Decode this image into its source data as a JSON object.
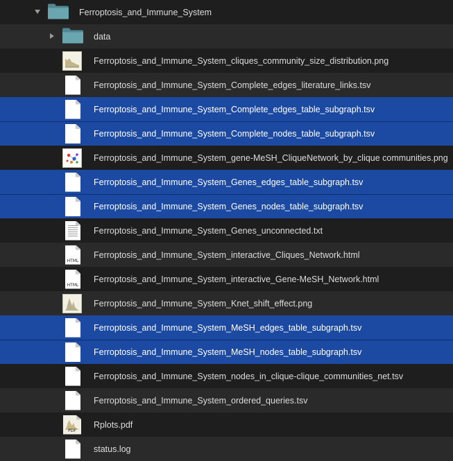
{
  "tree": {
    "root_folder": {
      "name": "Ferroptosis_and_Immune_System",
      "icon": "folder-icon",
      "expanded": true
    },
    "subfolder": {
      "name": "data",
      "icon": "folder-icon",
      "expanded": false
    },
    "files": [
      {
        "name": "Ferroptosis_and_Immune_System_cliques_community_size_distribution.png",
        "icon": "image-thumbnail-icon",
        "selected": false
      },
      {
        "name": "Ferroptosis_and_Immune_System_Complete_edges_literature_links.tsv",
        "icon": "document-icon",
        "selected": false
      },
      {
        "name": "Ferroptosis_and_Immune_System_Complete_edges_table_subgraph.tsv",
        "icon": "document-icon",
        "selected": true
      },
      {
        "name": "Ferroptosis_and_Immune_System_Complete_nodes_table_subgraph.tsv",
        "icon": "document-icon",
        "selected": true
      },
      {
        "name": "Ferroptosis_and_Immune_System_gene-MeSH_CliqueNetwork_by_clique communities.png",
        "icon": "network-image-icon",
        "selected": false
      },
      {
        "name": "Ferroptosis_and_Immune_System_Genes_edges_table_subgraph.tsv",
        "icon": "document-icon",
        "selected": true
      },
      {
        "name": "Ferroptosis_and_Immune_System_Genes_nodes_table_subgraph.tsv",
        "icon": "document-icon",
        "selected": true
      },
      {
        "name": "Ferroptosis_and_Immune_System_Genes_unconnected.txt",
        "icon": "text-document-icon",
        "selected": false
      },
      {
        "name": "Ferroptosis_and_Immune_System_interactive_Cliques_Network.html",
        "icon": "html-document-icon",
        "badge": "HTML",
        "selected": false
      },
      {
        "name": "Ferroptosis_and_Immune_System_interactive_Gene-MeSH_Network.html",
        "icon": "html-document-icon",
        "badge": "HTML",
        "selected": false
      },
      {
        "name": "Ferroptosis_and_Immune_System_Knet_shift_effect.png",
        "icon": "image-thumbnail-icon",
        "selected": false
      },
      {
        "name": "Ferroptosis_and_Immune_System_MeSH_edges_table_subgraph.tsv",
        "icon": "document-icon",
        "selected": true
      },
      {
        "name": "Ferroptosis_and_Immune_System_MeSH_nodes_table_subgraph.tsv",
        "icon": "document-icon",
        "selected": true
      },
      {
        "name": "Ferroptosis_and_Immune_System_nodes_in_clique-clique_communities_net.tsv",
        "icon": "document-icon",
        "selected": false
      },
      {
        "name": "Ferroptosis_and_Immune_System_ordered_queries.tsv",
        "icon": "document-icon",
        "selected": false
      },
      {
        "name": "Rplots.pdf",
        "icon": "pdf-document-icon",
        "badge": "PDF",
        "selected": false
      },
      {
        "name": "status.log",
        "icon": "document-icon",
        "selected": false
      }
    ]
  },
  "colors": {
    "background": "#1e1e1e",
    "alt_row": "#2a2a2a",
    "selection": "#1c4aa2",
    "folder": "#5e9aa4",
    "text": "#dcdcdc"
  }
}
